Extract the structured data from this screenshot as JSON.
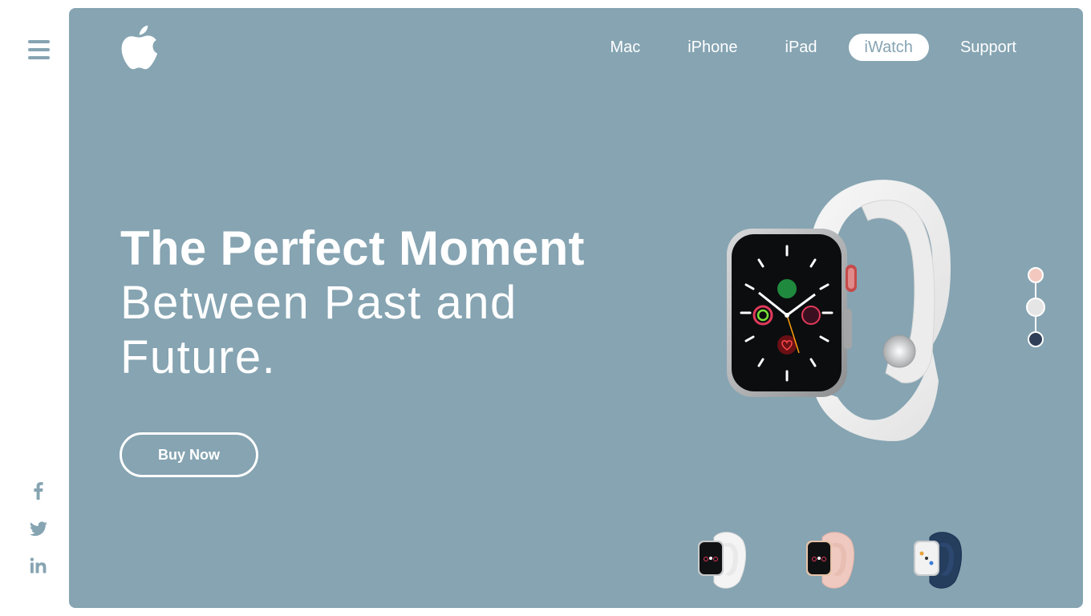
{
  "sidebar": {
    "menu_icon": "hamburger-menu-icon",
    "social": [
      {
        "name": "facebook",
        "icon": "facebook-icon"
      },
      {
        "name": "twitter",
        "icon": "twitter-icon"
      },
      {
        "name": "linkedin",
        "icon": "linkedin-icon"
      }
    ]
  },
  "header": {
    "logo_icon": "apple-logo-icon",
    "nav": [
      {
        "label": "Mac",
        "active": false
      },
      {
        "label": "iPhone",
        "active": false
      },
      {
        "label": "iPad",
        "active": false
      },
      {
        "label": "iWatch",
        "active": true
      },
      {
        "label": "Support",
        "active": false
      }
    ]
  },
  "hero": {
    "title_bold": "The Perfect Moment",
    "title_line2": "Between Past and",
    "title_line3": "Future.",
    "cta_label": "Buy Now"
  },
  "product": {
    "main_image": "white-sport-band-watch",
    "color_options": [
      {
        "name": "pink",
        "color": "#f3c9bf",
        "selected": false
      },
      {
        "name": "white",
        "color": "#e5e5e5",
        "selected": false
      },
      {
        "name": "navy",
        "color": "#2f3f57",
        "selected": true
      }
    ],
    "thumbnails": [
      {
        "name": "white",
        "band": "#f4f4f4",
        "case": "#c7c9cb"
      },
      {
        "name": "pink",
        "band": "#efc8bf",
        "case": "#e6c3a8"
      },
      {
        "name": "navy",
        "band": "#253e5e",
        "case": "#c9cbcd"
      }
    ]
  },
  "colors": {
    "accent": "#86a4b2",
    "text": "#ffffff"
  }
}
